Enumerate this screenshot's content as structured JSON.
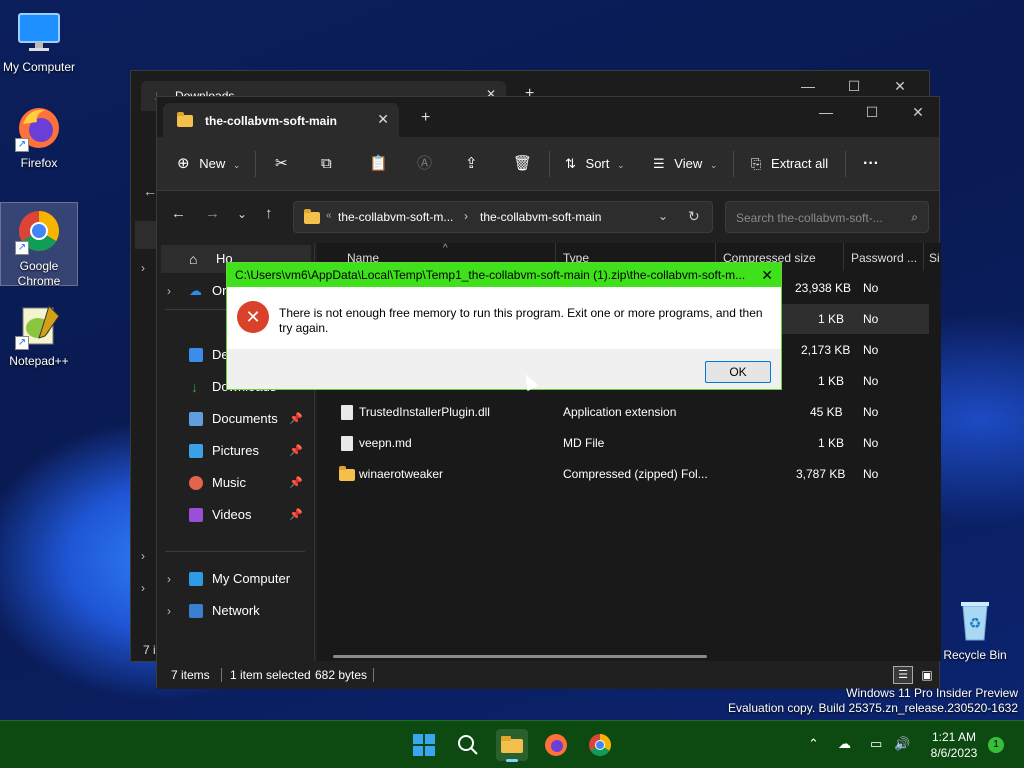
{
  "desktop": {
    "icons": [
      {
        "label": "My Computer"
      },
      {
        "label": "Firefox"
      },
      {
        "label": "Google Chrome"
      },
      {
        "label": "Notepad++"
      },
      {
        "label": "Recycle Bin"
      }
    ],
    "watermark_line1": "Windows 11 Pro Insider Preview",
    "watermark_line2": "Evaluation copy. Build 25375.zn_release.230520-1632"
  },
  "back_window": {
    "tab_title": "Downloads",
    "side_letter": "7 i"
  },
  "explorer": {
    "tab_title": "the-collabvm-soft-main",
    "toolbar": {
      "new_label": "New",
      "sort_label": "Sort",
      "view_label": "View",
      "extract_label": "Extract all"
    },
    "address": {
      "segment1": "the-collabvm-soft-m...",
      "segment2": "the-collabvm-soft-main"
    },
    "search_placeholder": "Search the-collabvm-soft-...",
    "nav": {
      "home": "Ho",
      "onedrive": "Or",
      "desktop": "De",
      "downloads": "Downloads",
      "documents": "Documents",
      "pictures": "Pictures",
      "music": "Music",
      "videos": "Videos",
      "mycomputer": "My Computer",
      "network": "Network"
    },
    "columns": {
      "name": "Name",
      "type": "Type",
      "compressed": "Compressed size",
      "password": "Password ...",
      "size": "Si"
    },
    "rows": [
      {
        "compressed": "23,938 KB",
        "password": "No"
      },
      {
        "compressed": "1 KB",
        "password": "No"
      },
      {
        "compressed": "2,173 KB",
        "password": "No"
      },
      {
        "compressed": "1 KB",
        "password": "No"
      },
      {
        "name": "TrustedInstallerPlugin.dll",
        "type": "Application extension",
        "compressed": "45 KB",
        "password": "No"
      },
      {
        "name": "veepn.md",
        "type": "MD File",
        "compressed": "1 KB",
        "password": "No"
      },
      {
        "name": "winaerotweaker",
        "type": "Compressed (zipped) Fol...",
        "compressed": "3,787 KB",
        "password": "No"
      }
    ],
    "status": {
      "items": "7 items",
      "selected": "1 item selected",
      "bytes": "682 bytes"
    }
  },
  "dialog": {
    "title": "C:\\Users\\vm6\\AppData\\Local\\Temp\\Temp1_the-collabvm-soft-main (1).zip\\the-collabvm-soft-m...",
    "message": "There is not enough free memory to run this program. Exit one or more programs, and then try again.",
    "ok_label": "OK",
    "accent": "#3ee11a"
  },
  "taskbar": {
    "time": "1:21 AM",
    "date": "8/6/2023",
    "notification_count": "1",
    "color": "#0c4a12"
  }
}
